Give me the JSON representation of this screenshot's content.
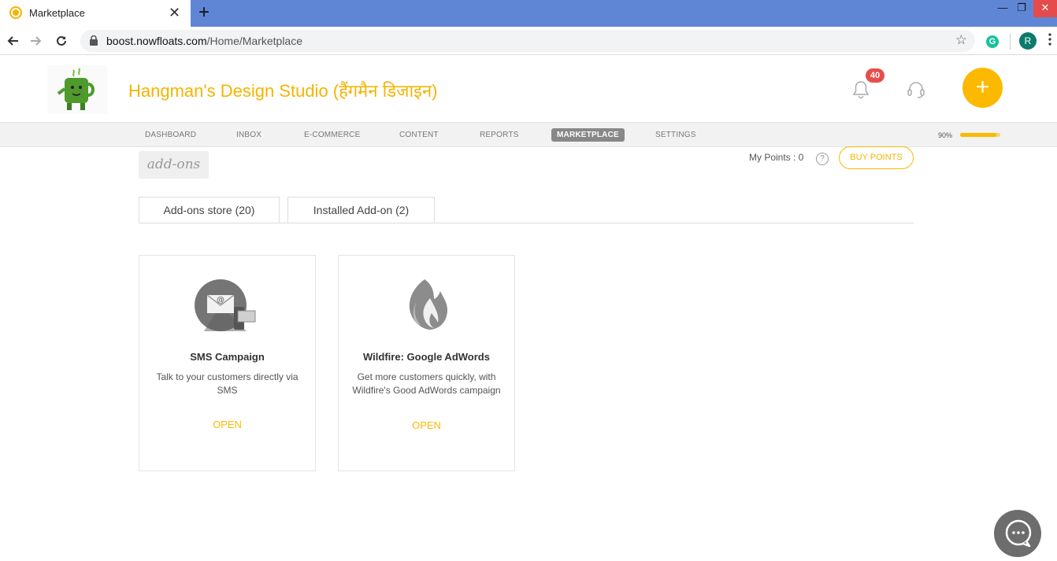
{
  "browser": {
    "tab_title": "Marketplace",
    "tab_close": "✕",
    "new_tab": "+",
    "window_controls": {
      "minimize": "—",
      "maximize": "❐",
      "close": "✕"
    },
    "url_domain": "boost.nowfloats.com",
    "url_path": "/Home/Marketplace",
    "extension_letter": "G",
    "profile_initial": "R",
    "icons": [
      "back-icon",
      "forward-icon",
      "reload-icon",
      "lock-icon",
      "star-icon",
      "menu-icon"
    ]
  },
  "header": {
    "business_name": "Hangman's Design Studio (हैंगमैन डिजाइन)",
    "notification_count": "40",
    "add_button": "+",
    "brand_color": "#fcb900",
    "badge_color": "#e84d4d"
  },
  "nav": {
    "items": [
      {
        "label": "DASHBOARD",
        "active": false
      },
      {
        "label": "INBOX",
        "active": false
      },
      {
        "label": "E-COMMERCE",
        "active": false
      },
      {
        "label": "CONTENT",
        "active": false
      },
      {
        "label": "REPORTS",
        "active": false
      },
      {
        "label": "MARKETPLACE",
        "active": true
      },
      {
        "label": "SETTINGS",
        "active": false
      }
    ],
    "progress_text": "90%",
    "progress_value": 0.9
  },
  "main": {
    "section_chip": "add-ons",
    "points_label": "My Points : 0",
    "help_symbol": "?",
    "buy_points": "BUY POINTS",
    "tabs": [
      {
        "label": "Add-ons store (20)"
      },
      {
        "label": "Installed Add-on (2)"
      }
    ],
    "cards": [
      {
        "icon": "email-sms-icon",
        "title": "SMS Campaign",
        "description": "Talk to your customers directly via SMS",
        "action": "OPEN"
      },
      {
        "icon": "flame-icon",
        "title": "Wildfire: Google AdWords",
        "description": "Get more customers quickly, with Wildfire's Good AdWords campaign",
        "action": "OPEN"
      }
    ]
  }
}
